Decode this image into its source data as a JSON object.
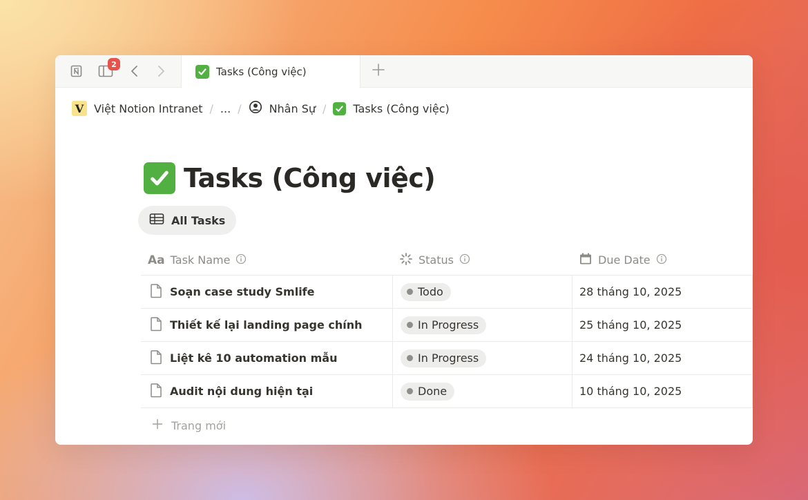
{
  "tabbar": {
    "notifications_count": "2",
    "active_tab": {
      "label": "Tasks (Công việc)",
      "icon": "check-box-icon"
    }
  },
  "breadcrumb": {
    "items": [
      {
        "label": "Việt Notion Intranet",
        "icon": "v-logo-icon",
        "logo_letter": "V"
      },
      {
        "label": "..."
      },
      {
        "label": "Nhân Sự",
        "icon": "user-circle-icon"
      },
      {
        "label": "Tasks (Công việc)",
        "icon": "check-box-icon"
      }
    ]
  },
  "page": {
    "title": "Tasks (Công việc)",
    "view_label": "All Tasks"
  },
  "table": {
    "columns": [
      {
        "label": "Task Name",
        "icon": "text-aa-icon"
      },
      {
        "label": "Status",
        "icon": "status-spinner-icon"
      },
      {
        "label": "Due Date",
        "icon": "calendar-icon"
      }
    ],
    "rows": [
      {
        "name": "Soạn case study Smlife",
        "status": "Todo",
        "due": "28 tháng 10, 2025"
      },
      {
        "name": "Thiết kế lại landing page chính",
        "status": "In Progress",
        "due": "25 tháng 10, 2025"
      },
      {
        "name": "Liệt kê 10 automation mẫu",
        "status": "In Progress",
        "due": "24 tháng 10, 2025"
      },
      {
        "name": "Audit nội dung hiện tại",
        "status": "Done",
        "due": "10 tháng 10, 2025"
      }
    ],
    "new_row_label": "Trang mới"
  },
  "colors": {
    "check_green": "#52b043",
    "badge_red": "#e5534b",
    "status_dot": "#8f8e8a"
  }
}
